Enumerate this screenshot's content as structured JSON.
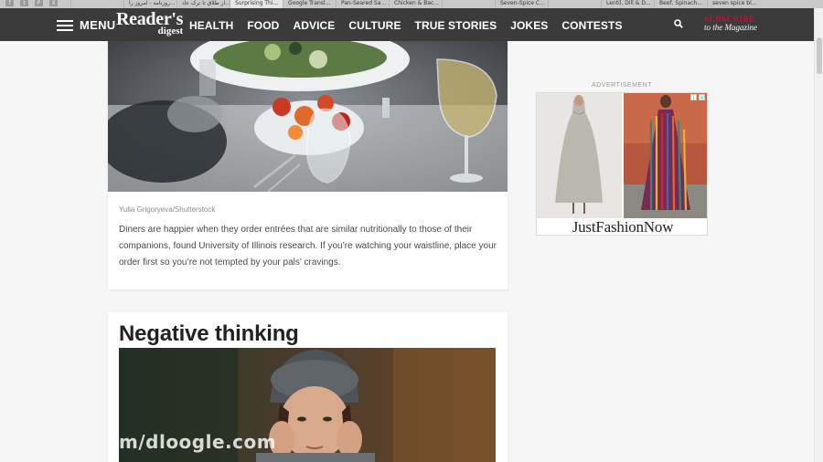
{
  "browser": {
    "tabs": [
      {
        "label": "",
        "active": false
      },
      {
        "label": "روزنامه - امروز را...",
        "active": false
      },
      {
        "label": "از طلاق تا ترک عاد...",
        "active": false
      },
      {
        "label": "Surprising Thi...",
        "active": true
      },
      {
        "label": "Google Transl...",
        "active": false
      },
      {
        "label": "Pan-Seared Sa...",
        "active": false
      },
      {
        "label": "Chicken & Bac...",
        "active": false
      },
      {
        "label": "",
        "active": false
      },
      {
        "label": "Seven-Spice C...",
        "active": false
      },
      {
        "label": "",
        "active": false
      },
      {
        "label": "Lentil, Dill & D...",
        "active": false
      },
      {
        "label": "Beef, Spinach...",
        "active": false
      },
      {
        "label": "seven spice bl...",
        "active": false
      }
    ]
  },
  "header": {
    "menu_label": "MENU",
    "logo_line1": "Reader's",
    "logo_line2": "digest",
    "nav": [
      "HEALTH",
      "FOOD",
      "ADVICE",
      "CULTURE",
      "TRUE STORIES",
      "JOKES",
      "CONTESTS"
    ],
    "subscribe_line1": "SUBSCRIBE",
    "subscribe_line2": "to the Magazine"
  },
  "article": {
    "photo1_credit": "Yulia Grigoryeva/Shutterstock",
    "caption": "Diners are happier when they order entrées that are similar nutritionally to those of their companions, found University of Illinois research. If you’re watching your waistline, place your order first so you’re not tempted by your pals’ cravings.",
    "section_heading": "Negative thinking"
  },
  "ad": {
    "label": "ADVERTISEMENT",
    "brand": "JustFashionNow",
    "choices_icons": [
      "adchoices-icon",
      "close-icon"
    ]
  },
  "watermark": "m/dloogle.com",
  "colors": {
    "header_bg": "#3b3b3b",
    "subscribe_accent": "#c4122f",
    "page_bg": "#f6f6f6"
  }
}
